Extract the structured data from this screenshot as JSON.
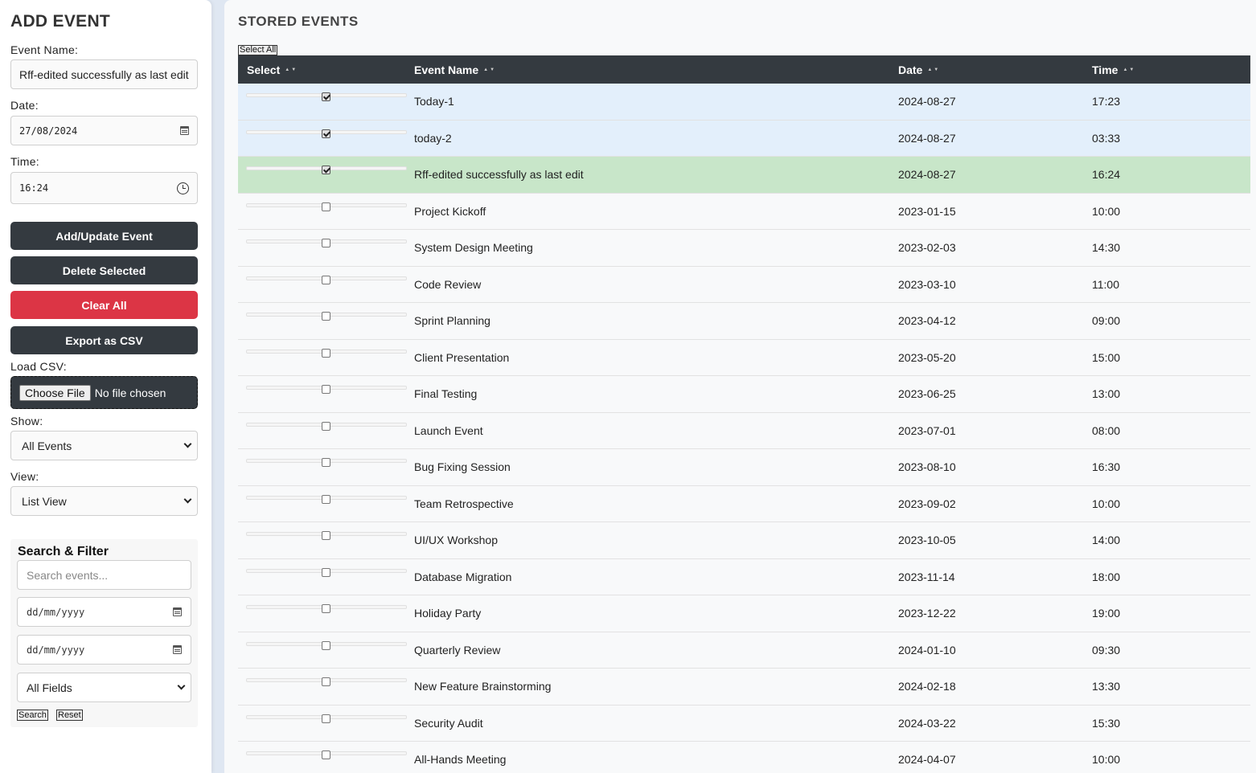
{
  "left": {
    "title": "ADD EVENT",
    "event_name_label": "Event Name:",
    "event_name_value": "Rff-edited successfully as last edit",
    "date_label": "Date:",
    "date_value": "27/08/2024",
    "time_label": "Time:",
    "time_value": "16:24",
    "add_button": "Add/Update Event",
    "delete_button": "Delete Selected",
    "clear_button": "Clear All",
    "export_button": "Export as CSV",
    "load_csv_label": "Load CSV:",
    "choose_file": "Choose File",
    "no_file": "No file chosen",
    "show_label": "Show:",
    "show_value": "All Events",
    "view_label": "View:",
    "view_value": "List View",
    "search": {
      "title": "Search & Filter",
      "placeholder": "Search events...",
      "date_from": "dd/mm/yyyy",
      "date_to": "dd/mm/yyyy",
      "fields_value": "All Fields",
      "search_button": "Search",
      "reset_button": "Reset"
    }
  },
  "right": {
    "title": "STORED EVENTS",
    "select_all": "Select All",
    "headers": [
      "Select",
      "Event Name",
      "Date",
      "Time"
    ],
    "rows": [
      {
        "name": "Today-1",
        "date": "2024-08-27",
        "time": "17:23",
        "checked": true
      },
      {
        "name": "today-2",
        "date": "2024-08-27",
        "time": "03:33",
        "checked": true
      },
      {
        "name": "Rff-edited successfully as last edit",
        "date": "2024-08-27",
        "time": "16:24",
        "checked": true,
        "active": true
      },
      {
        "name": "Project Kickoff",
        "date": "2023-01-15",
        "time": "10:00",
        "checked": false
      },
      {
        "name": "System Design Meeting",
        "date": "2023-02-03",
        "time": "14:30",
        "checked": false
      },
      {
        "name": "Code Review",
        "date": "2023-03-10",
        "time": "11:00",
        "checked": false
      },
      {
        "name": "Sprint Planning",
        "date": "2023-04-12",
        "time": "09:00",
        "checked": false
      },
      {
        "name": "Client Presentation",
        "date": "2023-05-20",
        "time": "15:00",
        "checked": false
      },
      {
        "name": "Final Testing",
        "date": "2023-06-25",
        "time": "13:00",
        "checked": false
      },
      {
        "name": "Launch Event",
        "date": "2023-07-01",
        "time": "08:00",
        "checked": false
      },
      {
        "name": "Bug Fixing Session",
        "date": "2023-08-10",
        "time": "16:30",
        "checked": false
      },
      {
        "name": "Team Retrospective",
        "date": "2023-09-02",
        "time": "10:00",
        "checked": false
      },
      {
        "name": "UI/UX Workshop",
        "date": "2023-10-05",
        "time": "14:00",
        "checked": false
      },
      {
        "name": "Database Migration",
        "date": "2023-11-14",
        "time": "18:00",
        "checked": false
      },
      {
        "name": "Holiday Party",
        "date": "2023-12-22",
        "time": "19:00",
        "checked": false
      },
      {
        "name": "Quarterly Review",
        "date": "2024-01-10",
        "time": "09:30",
        "checked": false
      },
      {
        "name": "New Feature Brainstorming",
        "date": "2024-02-18",
        "time": "13:30",
        "checked": false
      },
      {
        "name": "Security Audit",
        "date": "2024-03-22",
        "time": "15:30",
        "checked": false
      },
      {
        "name": "All-Hands Meeting",
        "date": "2024-04-07",
        "time": "10:00",
        "checked": false
      }
    ]
  },
  "colors": {
    "dark_button": "#343a40",
    "danger_button": "#dc3545",
    "selected_row": "#e3effb",
    "active_row": "#c8e6c9"
  }
}
